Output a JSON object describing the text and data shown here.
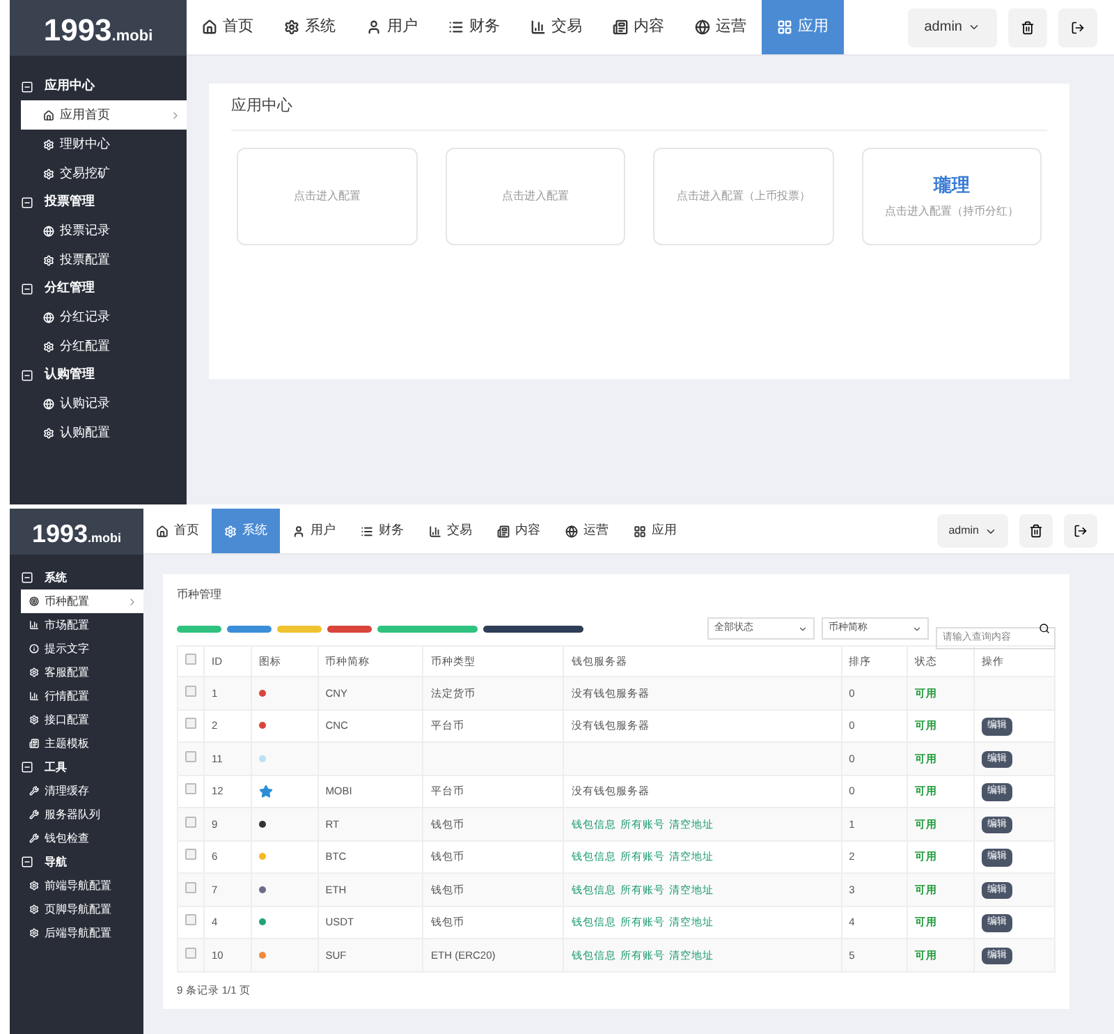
{
  "top_screen": {
    "logo": {
      "main": "1993",
      "sub": ".mobi"
    },
    "nav": [
      {
        "label": "首页",
        "selected": false
      },
      {
        "label": "系统",
        "selected": false
      },
      {
        "label": "用户",
        "selected": false
      },
      {
        "label": "财务",
        "selected": false
      },
      {
        "label": "交易",
        "selected": false
      },
      {
        "label": "内容",
        "selected": false
      },
      {
        "label": "运营",
        "selected": false
      },
      {
        "label": "应用",
        "selected": true
      }
    ],
    "user_menu": "admin",
    "sidebar": [
      {
        "label": "应用中心",
        "children": [
          {
            "label": "应用首页",
            "selected": true
          },
          {
            "label": "理财中心",
            "selected": false
          },
          {
            "label": "交易挖矿",
            "selected": false
          }
        ]
      },
      {
        "label": "投票管理",
        "children": [
          {
            "label": "投票记录",
            "selected": false
          },
          {
            "label": "投票配置",
            "selected": false
          }
        ]
      },
      {
        "label": "分红管理",
        "children": [
          {
            "label": "分红记录",
            "selected": false
          },
          {
            "label": "分红配置",
            "selected": false
          }
        ]
      },
      {
        "label": "认购管理",
        "children": [
          {
            "label": "认购记录",
            "selected": false
          },
          {
            "label": "认购配置",
            "selected": false
          }
        ]
      }
    ],
    "panel_title": "应用中心",
    "cards": [
      {
        "text": "点击进入配置"
      },
      {
        "text": "点击进入配置"
      },
      {
        "text": "点击进入配置（上币投票）"
      },
      {
        "title": "瓏理",
        "text": "点击进入配置（持币分红）"
      }
    ]
  },
  "bottom_screen": {
    "logo": {
      "main": "1993",
      "sub": ".mobi"
    },
    "nav": [
      {
        "label": "首页",
        "selected": false
      },
      {
        "label": "系统",
        "selected": true
      },
      {
        "label": "用户",
        "selected": false
      },
      {
        "label": "财务",
        "selected": false
      },
      {
        "label": "交易",
        "selected": false
      },
      {
        "label": "内容",
        "selected": false
      },
      {
        "label": "运营",
        "selected": false
      },
      {
        "label": "应用",
        "selected": false
      }
    ],
    "user_menu": "admin",
    "sidebar": [
      {
        "label": "系统",
        "children": [
          {
            "label": "币种配置",
            "selected": true
          },
          {
            "label": "市场配置",
            "selected": false
          },
          {
            "label": "提示文字",
            "selected": false
          },
          {
            "label": "客服配置",
            "selected": false
          },
          {
            "label": "行情配置",
            "selected": false
          },
          {
            "label": "接口配置",
            "selected": false
          },
          {
            "label": "主题模板",
            "selected": false
          }
        ]
      },
      {
        "label": "工具",
        "children": [
          {
            "label": "清理缓存",
            "selected": false
          },
          {
            "label": "服务器队列",
            "selected": false
          },
          {
            "label": "钱包检查",
            "selected": false
          }
        ]
      },
      {
        "label": "导航",
        "children": [
          {
            "label": "前端导航配置",
            "selected": false
          },
          {
            "label": "页脚导航配置",
            "selected": false
          },
          {
            "label": "后端导航配置",
            "selected": false
          }
        ]
      }
    ],
    "panel_title": "币种管理",
    "toolbar_buttons": [
      {
        "color": "#2ec27e"
      },
      {
        "color": "#3b8fd9"
      },
      {
        "color": "#f0c330"
      },
      {
        "color": "#d9453a"
      },
      {
        "color": "#2ec27e"
      },
      {
        "color": "#2d3e56"
      }
    ],
    "filters": {
      "status": "全部状态",
      "field": "币种简称",
      "search_placeholder": "请输入查询内容"
    },
    "select_all": {
      "checked": false
    },
    "columns": [
      "ID",
      "图标",
      "币种简称",
      "币种类型",
      "钱包服务器",
      "排序",
      "状态",
      "操作"
    ],
    "rows": [
      {
        "checked": false,
        "id": "1",
        "icon": {
          "kind": "dot",
          "color": "#d9453a"
        },
        "symbol": "CNY",
        "type": "法定货币",
        "server": {
          "kind": "text",
          "text": "没有钱包服务器"
        },
        "sort": "0",
        "status": "可用",
        "edit": null
      },
      {
        "checked": false,
        "id": "2",
        "icon": {
          "kind": "dot",
          "color": "#d9453a"
        },
        "symbol": "CNC",
        "type": "平台币",
        "server": {
          "kind": "text",
          "text": "没有钱包服务器"
        },
        "sort": "0",
        "status": "可用",
        "edit": "编辑"
      },
      {
        "checked": false,
        "id": "11",
        "icon": {
          "kind": "dot",
          "color": "#bcdff5"
        },
        "symbol": "",
        "type": "",
        "server": null,
        "sort": "0",
        "status": "可用",
        "edit": "编辑"
      },
      {
        "checked": false,
        "id": "12",
        "icon": {
          "kind": "star",
          "color": "#2a8fd6"
        },
        "symbol": "MOBI",
        "type": "平台币",
        "server": {
          "kind": "text",
          "text": "没有钱包服务器"
        },
        "sort": "0",
        "status": "可用",
        "edit": "编辑"
      },
      {
        "checked": false,
        "id": "9",
        "icon": {
          "kind": "dot",
          "color": "#333333"
        },
        "symbol": "RT",
        "type": "钱包币",
        "server": {
          "kind": "links",
          "links": [
            "钱包信息",
            "所有账号",
            "清空地址"
          ]
        },
        "sort": "1",
        "status": "可用",
        "edit": "编辑"
      },
      {
        "checked": false,
        "id": "6",
        "icon": {
          "kind": "dot",
          "color": "#f5b921"
        },
        "symbol": "BTC",
        "type": "钱包币",
        "server": {
          "kind": "links",
          "links": [
            "钱包信息",
            "所有账号",
            "清空地址"
          ]
        },
        "sort": "2",
        "status": "可用",
        "edit": "编辑"
      },
      {
        "checked": false,
        "id": "7",
        "icon": {
          "kind": "dot",
          "color": "#6b6b8a"
        },
        "symbol": "ETH",
        "type": "钱包币",
        "server": {
          "kind": "links",
          "links": [
            "钱包信息",
            "所有账号",
            "清空地址"
          ]
        },
        "sort": "3",
        "status": "可用",
        "edit": "编辑"
      },
      {
        "checked": false,
        "id": "4",
        "icon": {
          "kind": "dot",
          "color": "#26a17b"
        },
        "symbol": "USDT",
        "type": "钱包币",
        "server": {
          "kind": "links",
          "links": [
            "钱包信息",
            "所有账号",
            "清空地址"
          ]
        },
        "sort": "4",
        "status": "可用",
        "edit": "编辑"
      },
      {
        "checked": false,
        "id": "10",
        "icon": {
          "kind": "dot",
          "color": "#f08a3c"
        },
        "symbol": "SUF",
        "type": "ETH (ERC20)",
        "server": {
          "kind": "links",
          "links": [
            "钱包信息",
            "所有账号",
            "清空地址"
          ]
        },
        "sort": "5",
        "status": "可用",
        "edit": "编辑"
      }
    ],
    "footer": "9 条记录 1/1 页"
  }
}
